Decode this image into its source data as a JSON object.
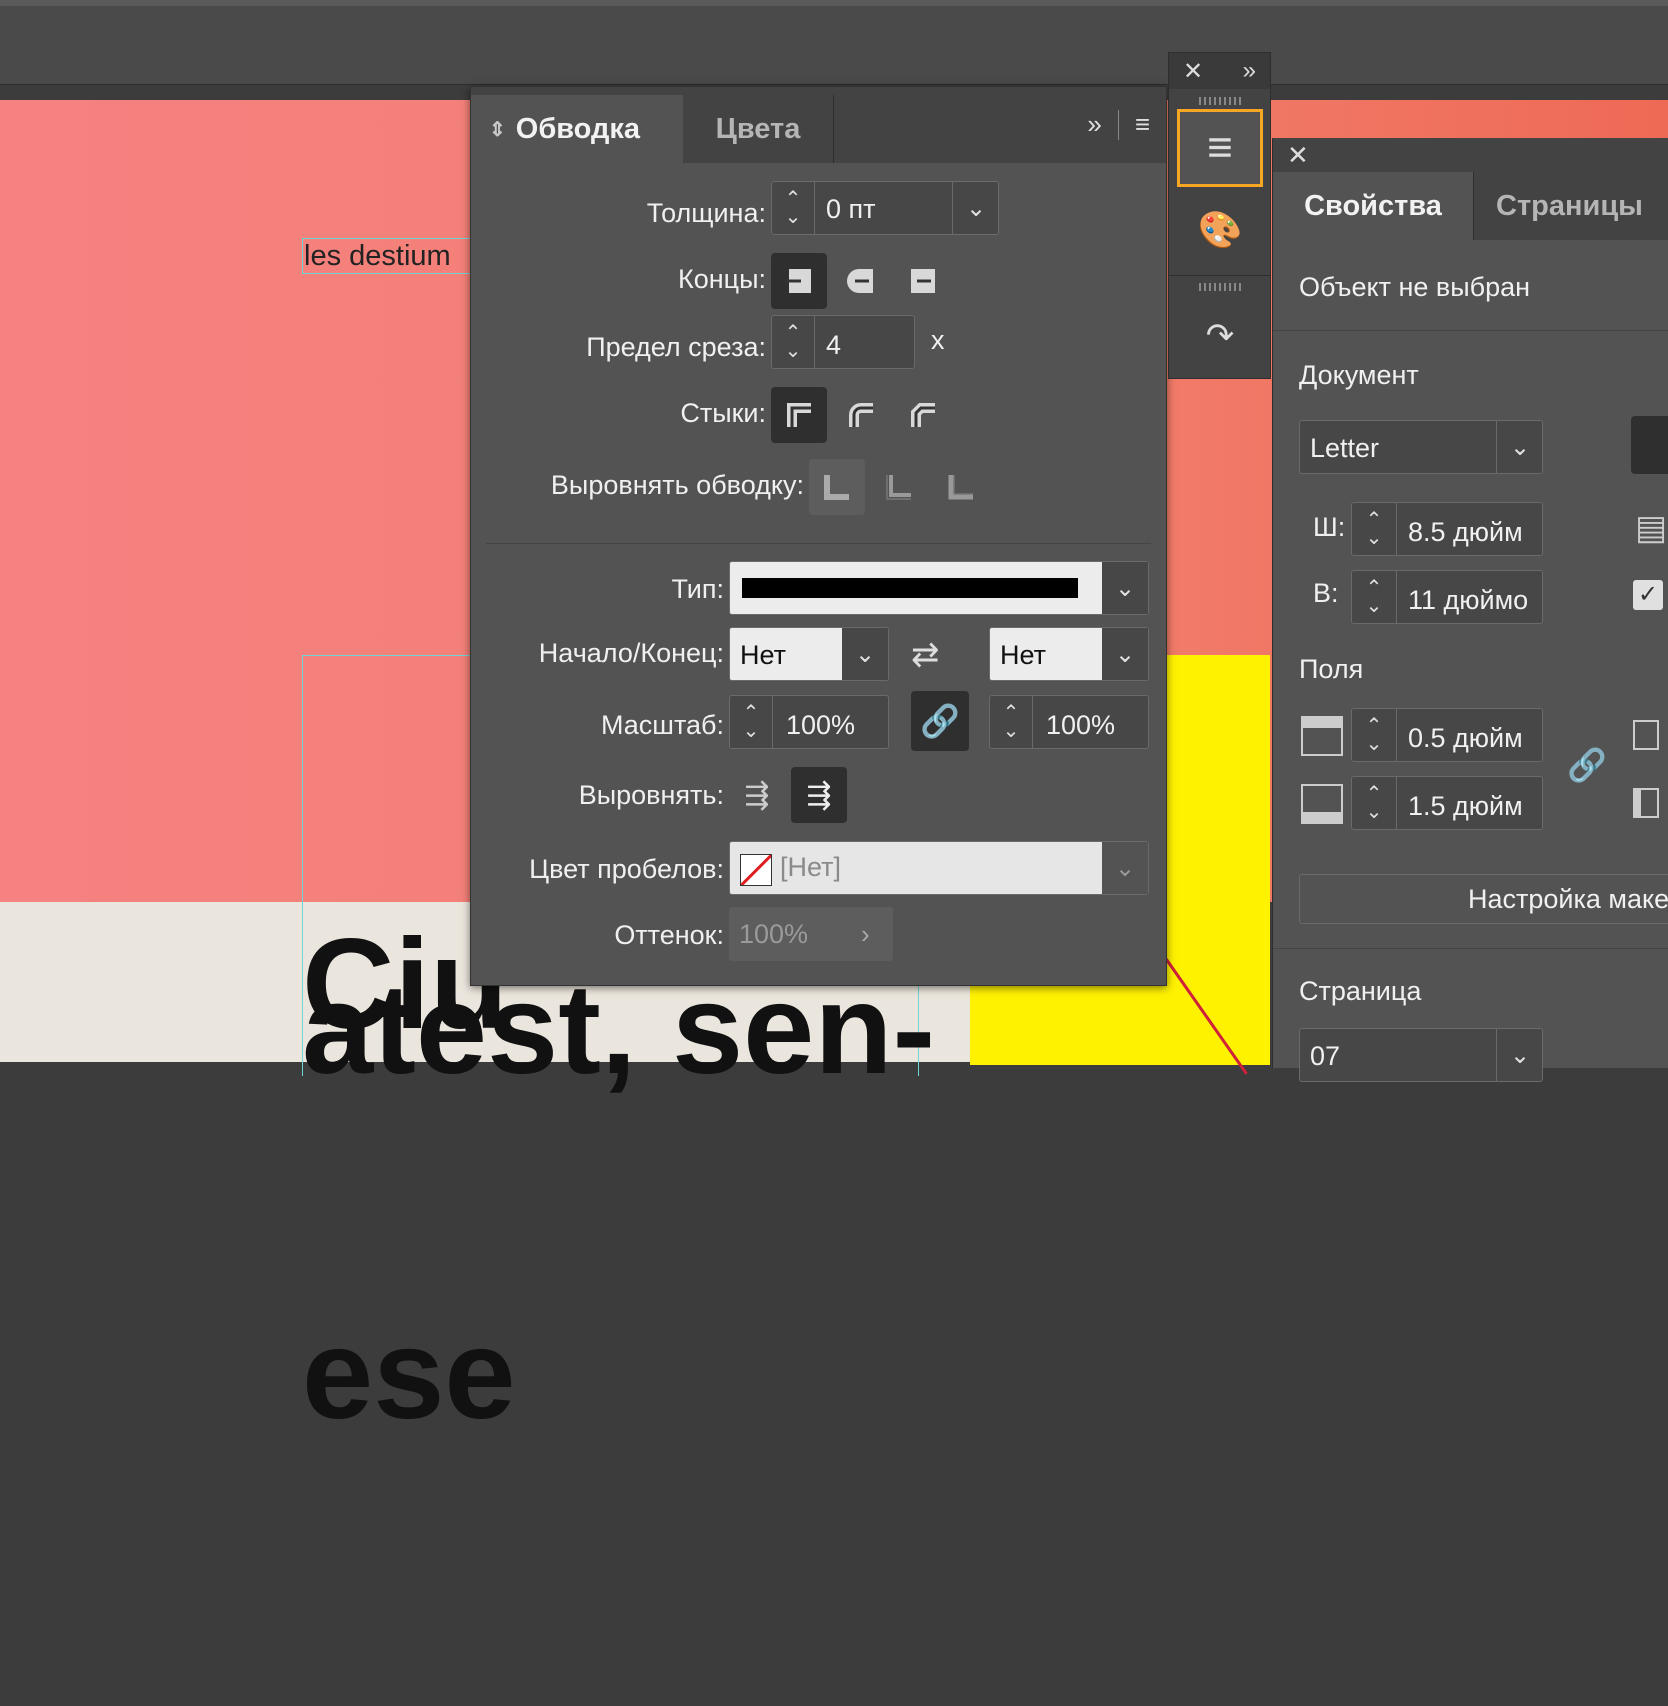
{
  "canvas": {
    "small_text": "les destium",
    "big_line1": "Ciu",
    "big_line2": "ese",
    "big_line3": "atest, sen-"
  },
  "stroke_panel": {
    "tabs": [
      {
        "label": "Обводка"
      },
      {
        "label": "Цвета"
      }
    ],
    "weight_label": "Толщина:",
    "weight_value": "0 пт",
    "caps_label": "Концы:",
    "miter_label": "Предел среза:",
    "miter_value": "4",
    "miter_unit": "x",
    "joins_label": "Стыки:",
    "align_stroke_label": "Выровнять обводку:",
    "type_label": "Тип:",
    "start_end_label": "Начало/Конец:",
    "start_value": "Нет",
    "end_value": "Нет",
    "scale_label": "Масштаб:",
    "scale_start": "100%",
    "scale_end": "100%",
    "align_label": "Выровнять:",
    "gap_color_label": "Цвет пробелов:",
    "gap_color_value": "[Нет]",
    "tint_label": "Оттенок:",
    "tint_value": "100%"
  },
  "properties": {
    "tabs": [
      {
        "label": "Свойства"
      },
      {
        "label": "Страницы"
      }
    ],
    "no_selection": "Объект не выбран",
    "document_label": "Документ",
    "preset_value": "Letter",
    "width_label": "Ш:",
    "width_value": "8.5 дюйм",
    "height_label": "В:",
    "height_value": "11 дюймо",
    "margins_label": "Поля",
    "margin_top": "0.5 дюйм",
    "margin_bottom": "1.5 дюйм",
    "layout_button": "Настройка макета",
    "page_label": "Страница",
    "page_value": "07"
  },
  "colors": {
    "accent": "#f5a623",
    "panel": "#535353",
    "canvas_pink": "#f58181",
    "canvas_yellow": "#fff200"
  }
}
